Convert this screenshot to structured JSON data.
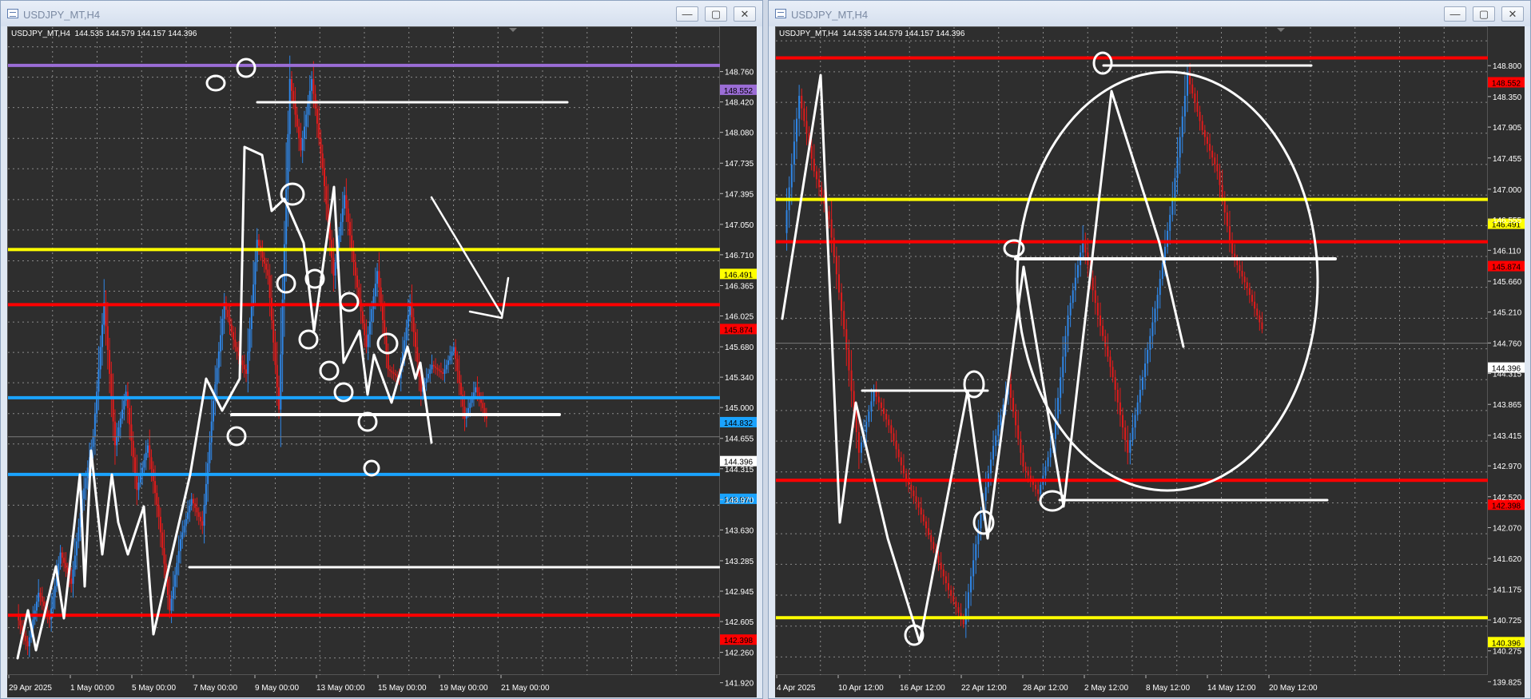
{
  "left": {
    "window_title": "USDJPY_MT,H4",
    "chart_info": "USDJPY_MT,H4  144.535 144.579 144.157 144.396",
    "controls": {
      "minimize": "—",
      "maximize": "▢",
      "close": "✕"
    },
    "chart_data": {
      "type": "candlestick",
      "symbol": "USDJPY_MT",
      "timeframe": "H4",
      "ohlc": {
        "open": 144.535,
        "high": 144.579,
        "low": 144.157,
        "close": 144.396
      },
      "ylim": [
        141.72,
        148.98
      ],
      "y_ticks": [
        148.76,
        148.42,
        148.08,
        147.735,
        147.395,
        147.05,
        146.71,
        146.365,
        146.025,
        145.68,
        145.34,
        145.0,
        144.655,
        144.315,
        143.97,
        143.63,
        143.285,
        142.945,
        142.605,
        142.26,
        141.92
      ],
      "x_ticks": [
        "29 Apr 2025",
        "1 May 00:00",
        "5 May 00:00",
        "7 May 00:00",
        "9 May 00:00",
        "13 May 00:00",
        "15 May 00:00",
        "19 May 00:00",
        "21 May 00:00"
      ],
      "price_lines": [
        {
          "value": 148.552,
          "label": "148.552",
          "color": "#9b6dd6"
        },
        {
          "value": 146.491,
          "label": "146.491",
          "color": "#ffff00"
        },
        {
          "value": 145.874,
          "label": "145.874",
          "color": "#ff0000"
        },
        {
          "value": 144.832,
          "label": "144.832",
          "color": "#1aa3ff"
        },
        {
          "value": 143.974,
          "label": "143.974",
          "color": "#1aa3ff"
        },
        {
          "value": 142.398,
          "label": "142.398",
          "color": "#ff0000"
        }
      ],
      "current_price": {
        "value": 144.396,
        "label": "144.396"
      },
      "series": [
        {
          "name": "price path",
          "values": [
            142.4,
            142.05,
            142.65,
            142.35,
            143.1,
            142.75,
            143.7,
            144.4,
            145.9,
            144.3,
            144.9,
            143.8,
            144.3,
            143.5,
            142.45,
            143.25,
            143.7,
            143.4,
            144.8,
            145.9,
            145.4,
            145.1,
            146.6,
            146.2,
            144.7,
            148.4,
            147.6,
            148.4,
            147.4,
            146.2,
            147.1,
            146.2,
            145.4,
            146.25,
            145.15,
            145.05,
            145.9,
            144.9,
            145.2,
            145.1,
            145.4,
            144.6,
            144.95,
            144.6
          ]
        }
      ]
    }
  },
  "right": {
    "window_title": "USDJPY_MT,H4",
    "chart_info": "USDJPY_MT,H4  144.535 144.579 144.157 144.396",
    "controls": {
      "minimize": "—",
      "maximize": "▢",
      "close": "✕"
    },
    "chart_data": {
      "type": "candlestick",
      "symbol": "USDJPY_MT",
      "timeframe": "H4",
      "ohlc": {
        "open": 144.535,
        "high": 144.579,
        "low": 144.157,
        "close": 144.396
      },
      "ylim": [
        139.55,
        149.0
      ],
      "y_ticks": [
        148.8,
        148.35,
        147.905,
        147.455,
        147.0,
        146.555,
        146.11,
        145.66,
        145.21,
        144.76,
        144.315,
        143.865,
        143.415,
        142.97,
        142.52,
        142.07,
        141.62,
        141.175,
        140.725,
        140.275,
        139.825
      ],
      "x_ticks": [
        "4 Apr 2025",
        "10 Apr 12:00",
        "16 Apr 12:00",
        "22 Apr 12:00",
        "28 Apr 12:00",
        "2 May 12:00",
        "8 May 12:00",
        "14 May 12:00",
        "20 May 12:00"
      ],
      "price_lines": [
        {
          "value": 148.552,
          "label": "148.552",
          "color": "#ff0000"
        },
        {
          "value": 146.491,
          "label": "146.491",
          "color": "#ffff00"
        },
        {
          "value": 145.874,
          "label": "145.874",
          "color": "#ff0000"
        },
        {
          "value": 142.398,
          "label": "142.398",
          "color": "#ff0000"
        },
        {
          "value": 140.396,
          "label": "140.396",
          "color": "#ffff00"
        }
      ],
      "current_price": {
        "value": 144.396,
        "label": "144.396"
      },
      "series": [
        {
          "name": "price path",
          "values": [
            146.0,
            148.0,
            146.9,
            146.2,
            144.6,
            142.8,
            143.7,
            143.2,
            142.5,
            142.0,
            141.4,
            140.8,
            140.3,
            141.7,
            142.9,
            143.8,
            142.6,
            142.2,
            143.0,
            144.8,
            145.9,
            144.8,
            143.9,
            142.8,
            143.9,
            145.1,
            146.5,
            148.3,
            147.5,
            146.9,
            145.7,
            145.2,
            144.6
          ]
        }
      ]
    }
  }
}
